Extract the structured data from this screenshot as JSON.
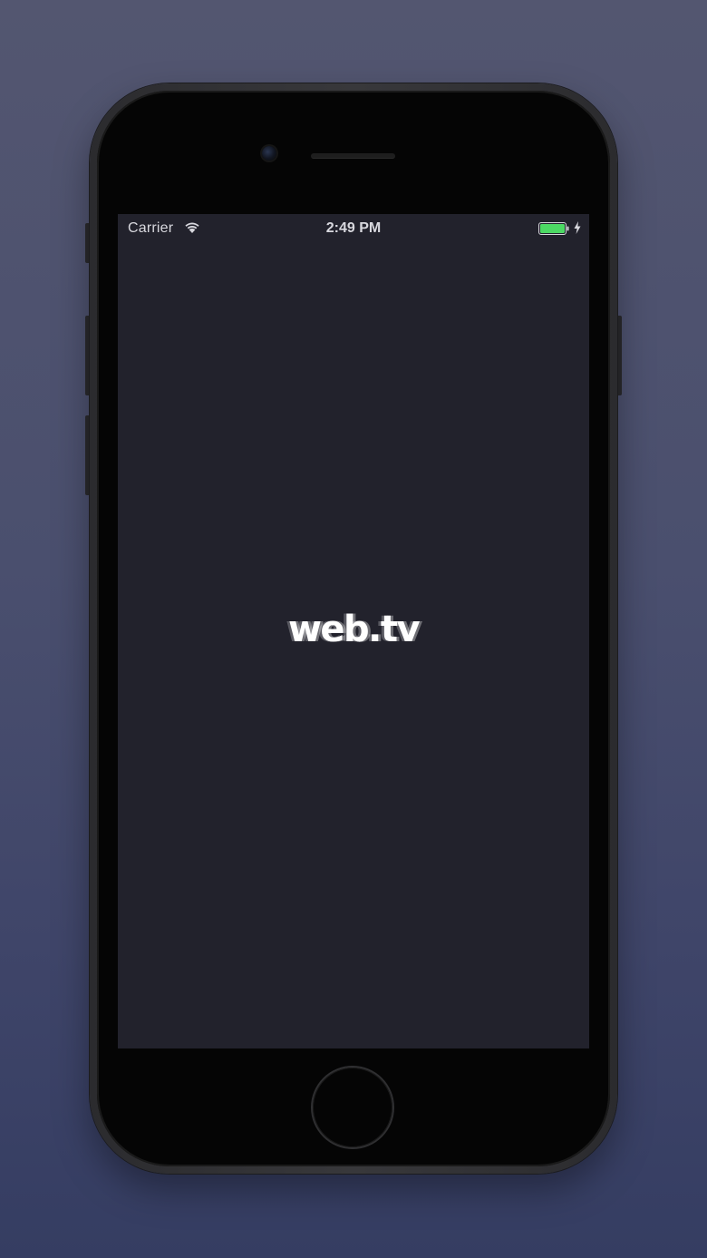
{
  "status_bar": {
    "carrier": "Carrier",
    "time": "2:49 PM",
    "wifi_icon": "wifi-icon",
    "battery_icon": "battery-icon",
    "charge_icon": "charging-bolt-icon",
    "battery_level": 1.0,
    "battery_color": "#4cd964"
  },
  "splash": {
    "logo_text": "web.tv",
    "background_color": "#22222c"
  },
  "device": {
    "frame_color": "#2b2b2e",
    "bezel_color": "#050505"
  }
}
